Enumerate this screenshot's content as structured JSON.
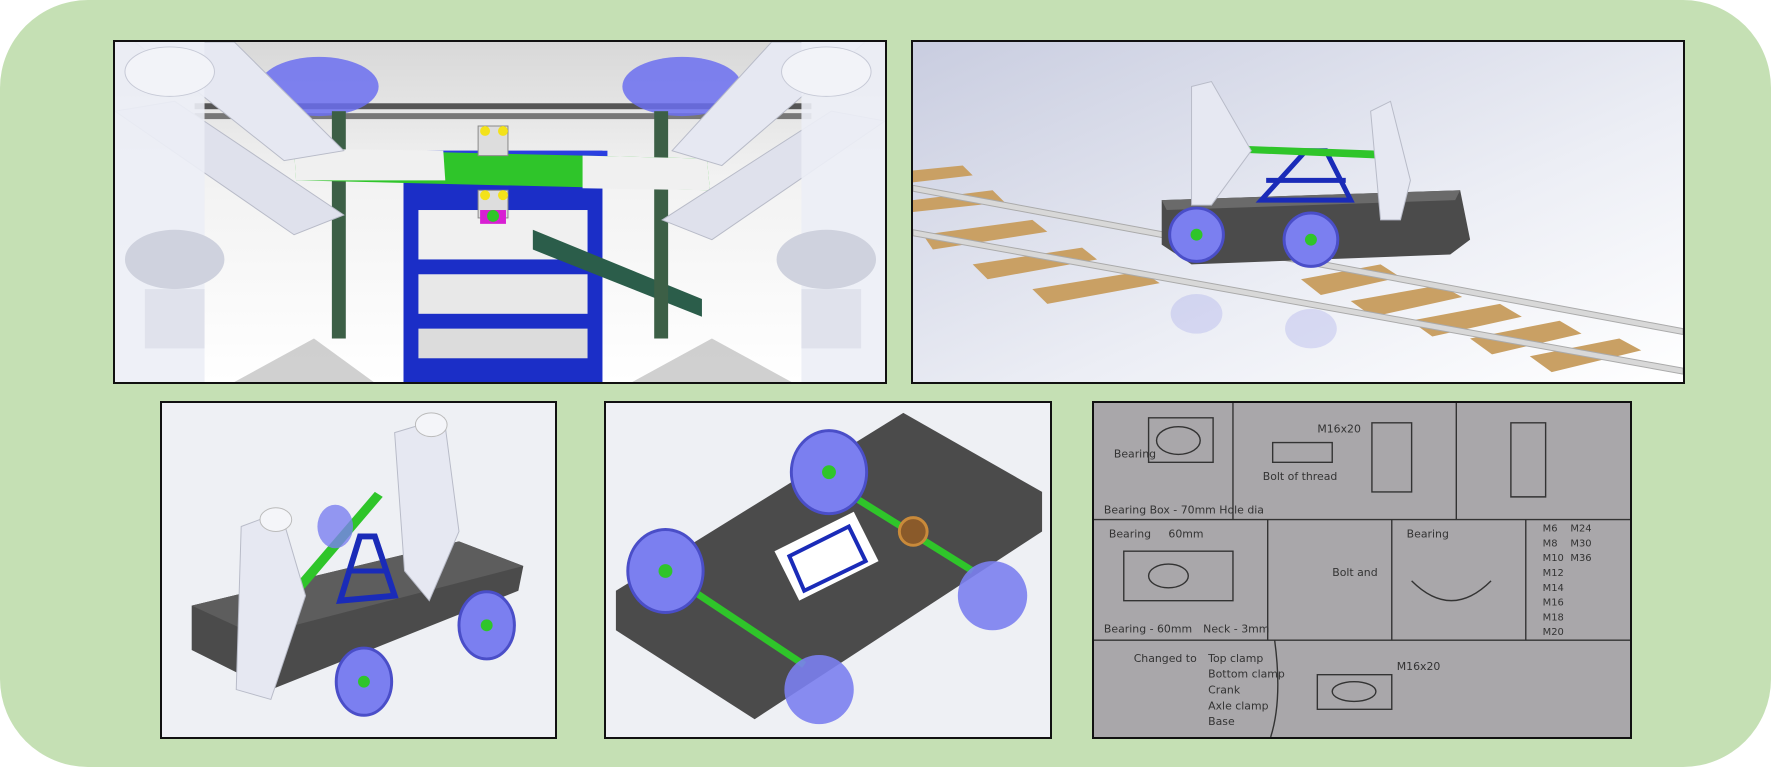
{
  "panels": [
    {
      "id": "closeup",
      "subject": "close-up of green hand-lever linkage between two operator figures"
    },
    {
      "id": "on-track",
      "subject": "rail trolley assembly on railway track"
    },
    {
      "id": "iso-top",
      "subject": "isometric view of trolley with two operator figures"
    },
    {
      "id": "underside",
      "subject": "underside view of chassis with wheels, axles and crank"
    },
    {
      "id": "sketch",
      "subject": "hand-drawn bearing sketches"
    }
  ],
  "sketch": {
    "lines": {
      "l1": "Bearing",
      "l2": "Bolt of thread",
      "l3": "M16x20",
      "l4": "Bearing Box - 70mm Hole dia",
      "l5": "Bearing",
      "l6": "60mm",
      "l7": "Bolt and",
      "l8": "Bearing",
      "l9": "Bearing - 60mm",
      "l10": "Neck - 3mm",
      "l11": "Changed to",
      "l12": "Top clamp",
      "l13": "Bottom clamp",
      "l14": "Crank",
      "l15": "Axle clamp",
      "l16": "Base",
      "l17": "M16x20"
    },
    "sizes": [
      "M6",
      "M8",
      "M10",
      "M12",
      "M14",
      "M16",
      "M18",
      "M20",
      "M24",
      "M30",
      "M36"
    ]
  },
  "colors": {
    "background": "#c5e0b4",
    "frame_blue": "#1a2bb8",
    "link_green": "#2fc52a",
    "wheel_purple": "#7b7ff0",
    "chassis_gray": "#4b4b4b",
    "sleeper_wood": "#c9a064"
  }
}
